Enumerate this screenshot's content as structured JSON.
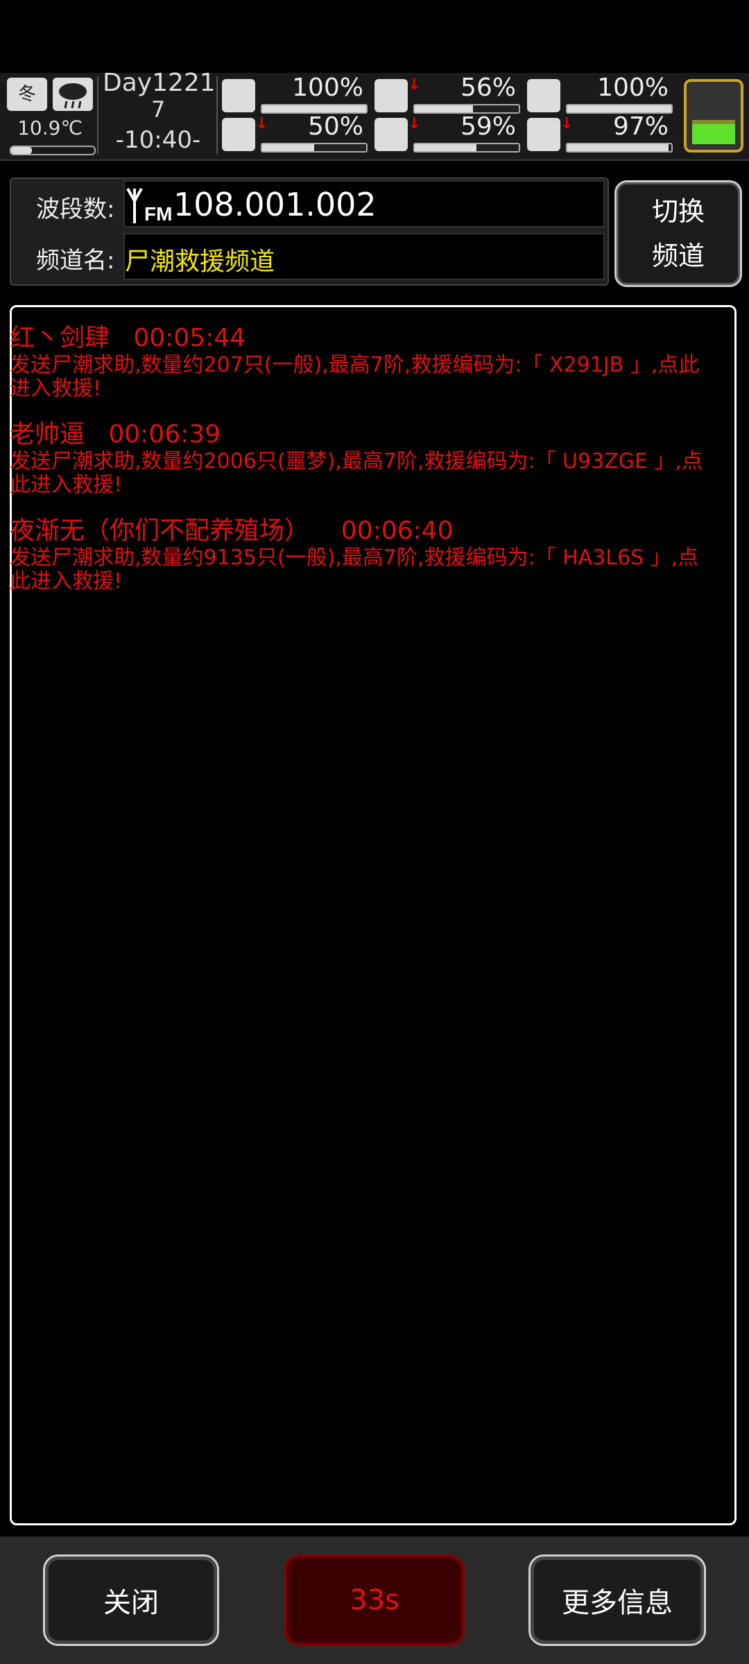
{
  "status": {
    "season": "冬",
    "temperature": "10.9℃",
    "day_line1": "Day1221",
    "day_line2": "7",
    "time": "-10:40-",
    "stats": [
      {
        "icon": "medkit-icon",
        "value": "100%",
        "arrow": "",
        "fill": 1.0
      },
      {
        "icon": "stomach-icon",
        "value": "56%",
        "arrow": "↓",
        "fill": 0.56
      },
      {
        "icon": "pill-icon",
        "value": "100%",
        "arrow": "",
        "fill": 1.0
      },
      {
        "icon": "boot-icon",
        "value": "50%",
        "arrow": "↓",
        "fill": 0.5
      },
      {
        "icon": "water-drop-icon",
        "value": "59%",
        "arrow": "↓",
        "fill": 0.59
      },
      {
        "icon": "heart-icon",
        "value": "97%",
        "arrow": "↓",
        "fill": 0.97
      }
    ],
    "battery_level": 0.3
  },
  "channel": {
    "band_label": "波段数:",
    "band_value": "108.001.002",
    "name_label": "频道名:",
    "name_value": "尸潮救援频道",
    "switch_line1": "切换",
    "switch_line2": "频道"
  },
  "messages": [
    {
      "sender": "红丶剑肆",
      "time": "00:05:44",
      "text": "发送尸潮求助,数量约207只(一般),最高7阶,救援编码为:「 X291JB 」,点此进入救援!"
    },
    {
      "sender": "老帅逼",
      "time": "00:06:39",
      "text": "发送尸潮求助,数量约2006只(噩梦),最高7阶,救援编码为:「 U93ZGE 」,点此进入救援!"
    },
    {
      "sender": "夜渐无（你们不配养殖场）",
      "time": "00:06:40",
      "text": "发送尸潮求助,数量约9135只(一般),最高7阶,救援编码为:「 HA3L6S 」,点此进入救援!"
    }
  ],
  "bottom": {
    "close_label": "关闭",
    "timer_label": "33s",
    "more_label": "更多信息"
  }
}
